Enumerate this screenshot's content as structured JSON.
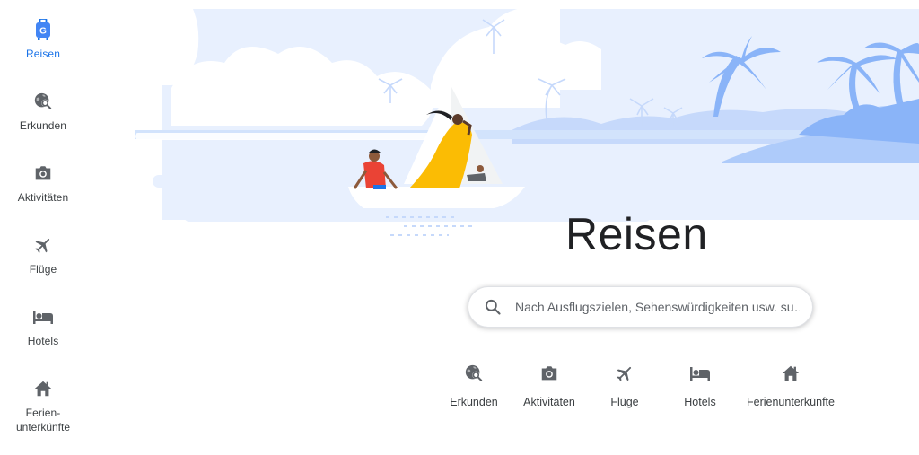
{
  "brand": {
    "accent": "#1a73e8",
    "icon_gray": "#5f6368"
  },
  "sidebar": {
    "items": [
      {
        "label": "Reisen",
        "icon": "travel-bag-icon",
        "active": true
      },
      {
        "label": "Erkunden",
        "icon": "explore-globe-icon"
      },
      {
        "label": "Aktivitäten",
        "icon": "camera-icon"
      },
      {
        "label": "Flüge",
        "icon": "plane-icon"
      },
      {
        "label": "Hotels",
        "icon": "bed-icon"
      },
      {
        "label": "Ferien-",
        "label2": "unterkünfte",
        "icon": "house-icon"
      }
    ]
  },
  "main": {
    "title": "Reisen",
    "search": {
      "placeholder": "Nach Ausflugszielen, Sehenswürdigkeiten usw. su…",
      "value": ""
    },
    "quick_links": [
      {
        "label": "Erkunden",
        "icon": "explore-globe-icon"
      },
      {
        "label": "Aktivitäten",
        "icon": "camera-icon"
      },
      {
        "label": "Flüge",
        "icon": "plane-icon"
      },
      {
        "label": "Hotels",
        "icon": "bed-icon"
      },
      {
        "label": "Ferienunterkünfte",
        "icon": "house-icon"
      }
    ]
  }
}
